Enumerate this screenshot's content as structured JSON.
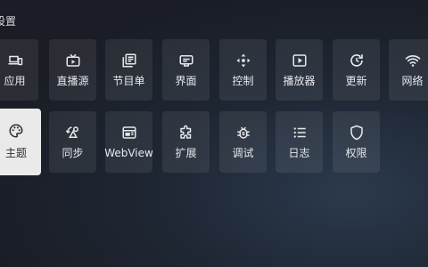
{
  "header": {
    "title": "设置"
  },
  "tiles": [
    {
      "label": "应用",
      "icon": "devices-icon"
    },
    {
      "label": "直播源",
      "icon": "tv-icon"
    },
    {
      "label": "节目单",
      "icon": "library-icon"
    },
    {
      "label": "界面",
      "icon": "subtitles-icon"
    },
    {
      "label": "控制",
      "icon": "move-arrows-icon"
    },
    {
      "label": "播放器",
      "icon": "play-box-icon"
    },
    {
      "label": "更新",
      "icon": "update-icon"
    },
    {
      "label": "网络",
      "icon": "wifi-icon"
    },
    {
      "label": "主题",
      "icon": "palette-icon",
      "selected": true
    },
    {
      "label": "同步",
      "icon": "sync-icon"
    },
    {
      "label": "WebView",
      "icon": "web-window-icon"
    },
    {
      "label": "扩展",
      "icon": "extension-icon"
    },
    {
      "label": "调试",
      "icon": "bug-icon"
    },
    {
      "label": "日志",
      "icon": "list-icon"
    },
    {
      "label": "权限",
      "icon": "shield-icon"
    }
  ]
}
